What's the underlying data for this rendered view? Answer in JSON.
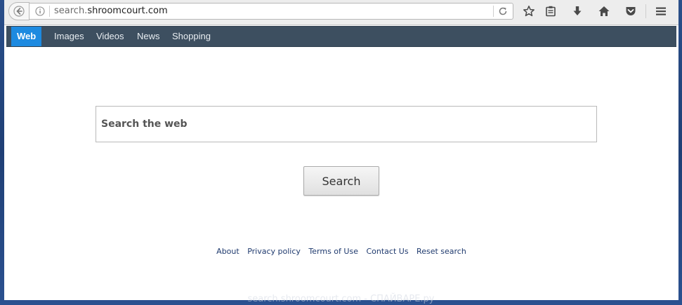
{
  "browser": {
    "url_prefix": "search.",
    "url_host": "shroomcourt.com",
    "icons": {
      "back": "back-arrow-icon",
      "info": "info-icon",
      "reload": "reload-icon",
      "bookmark": "star-icon",
      "reader": "clipboard-icon",
      "download": "download-arrow-icon",
      "home": "home-icon",
      "pocket": "pocket-icon",
      "menu": "hamburger-menu-icon"
    }
  },
  "nav": {
    "items": [
      {
        "label": "Web",
        "active": true
      },
      {
        "label": "Images",
        "active": false
      },
      {
        "label": "Videos",
        "active": false
      },
      {
        "label": "News",
        "active": false
      },
      {
        "label": "Shopping",
        "active": false
      }
    ]
  },
  "search": {
    "placeholder": "Search the web",
    "value": "",
    "button_label": "Search"
  },
  "footer": {
    "links": [
      "About",
      "Privacy policy",
      "Terms of Use",
      "Contact Us",
      "Reset search"
    ]
  },
  "watermark": "search.shroomcourt.com - СПАЙВАРЕ.ру",
  "colors": {
    "nav_bg": "#3d4f60",
    "nav_active": "#1d8ae0",
    "link": "#1f3a6e",
    "desktop_bg": "#2a4f8a"
  }
}
